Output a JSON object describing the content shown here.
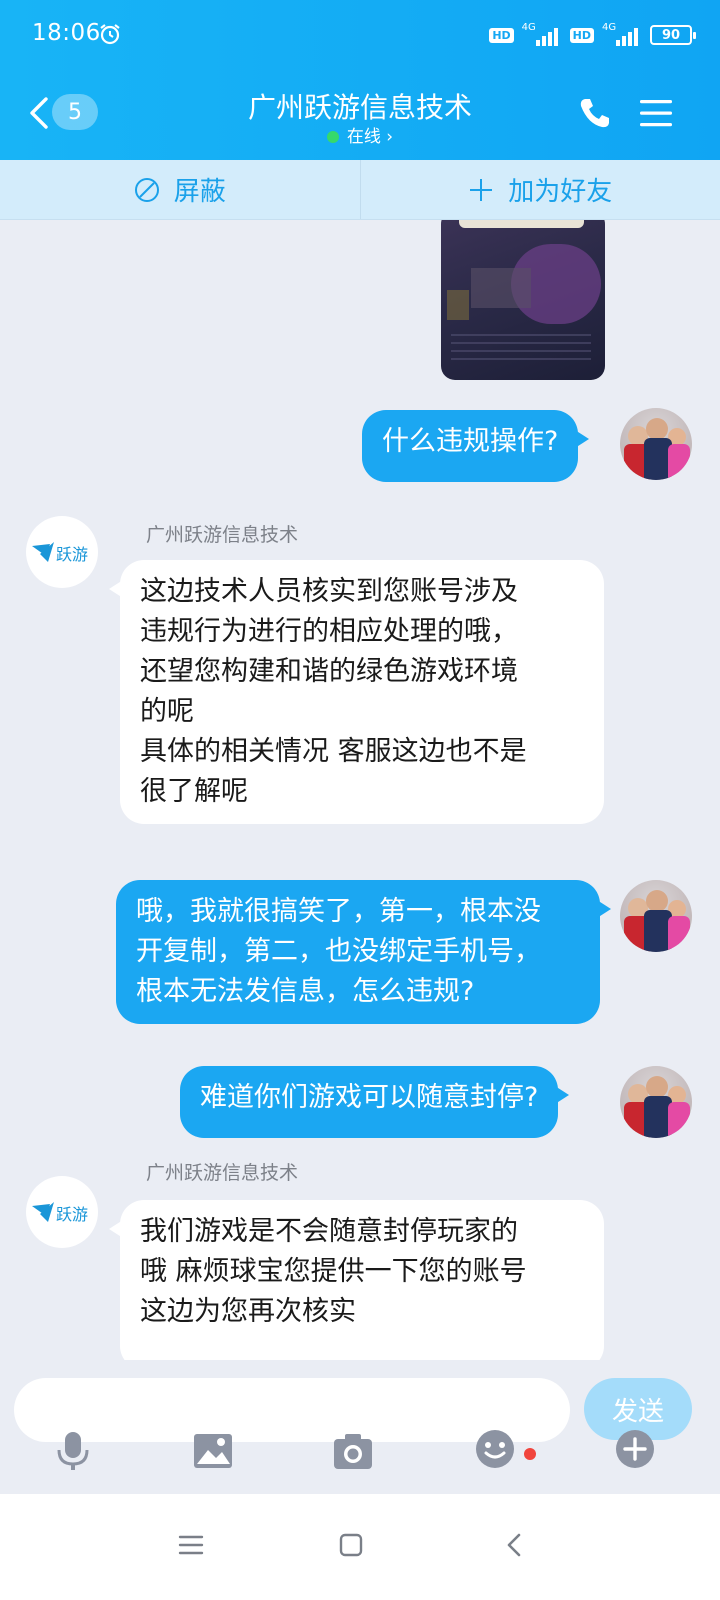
{
  "status_bar": {
    "time": "18:06",
    "hd_label_1": "HD",
    "hd_label_2": "HD",
    "network_1": "4G",
    "network_2": "4G",
    "battery": "90"
  },
  "header": {
    "unread_count": "5",
    "title": "广州跃游信息技术",
    "status": "在线 ›"
  },
  "actions": {
    "block": "屏蔽",
    "add_friend": "加为好友"
  },
  "messages": [
    {
      "from": "me",
      "lines": [
        "什么违规操作?"
      ]
    },
    {
      "from": "them",
      "sender": "广州跃游信息技术",
      "lines": [
        "这边技术人员核实到您账号涉及",
        "违规行为进行的相应处理的哦，",
        "还望您构建和谐的绿色游戏环境",
        "的呢",
        "具体的相关情况 客服这边也不是",
        "很了解呢"
      ]
    },
    {
      "from": "me",
      "lines": [
        "哦，我就很搞笑了，第一，根本没",
        "开复制，第二，也没绑定手机号，",
        "根本无法发信息，怎么违规?"
      ]
    },
    {
      "from": "me",
      "lines": [
        "难道你们游戏可以随意封停?"
      ]
    },
    {
      "from": "them",
      "sender": "广州跃游信息技术",
      "lines": [
        "我们游戏是不会随意封停玩家的",
        "哦 麻烦球宝您提供一下您的账号",
        "这边为您再次核实"
      ]
    }
  ],
  "company_logo_text": "跃游",
  "input": {
    "value": "",
    "send_label": "发送"
  },
  "colors": {
    "header": "#10a5f3",
    "my_bubble": "#1ba7f2",
    "their_bubble": "#ffffff",
    "action_bar": "#d3ecfb",
    "accent": "#1aa1ea"
  },
  "icons": [
    "alarm-icon",
    "back-icon",
    "phone-icon",
    "menu-icon",
    "block-icon",
    "plus-icon",
    "mic-icon",
    "image-icon",
    "camera-icon",
    "emoji-icon",
    "more-plus-icon",
    "nav-menu-icon",
    "nav-home-icon",
    "nav-back-icon"
  ]
}
